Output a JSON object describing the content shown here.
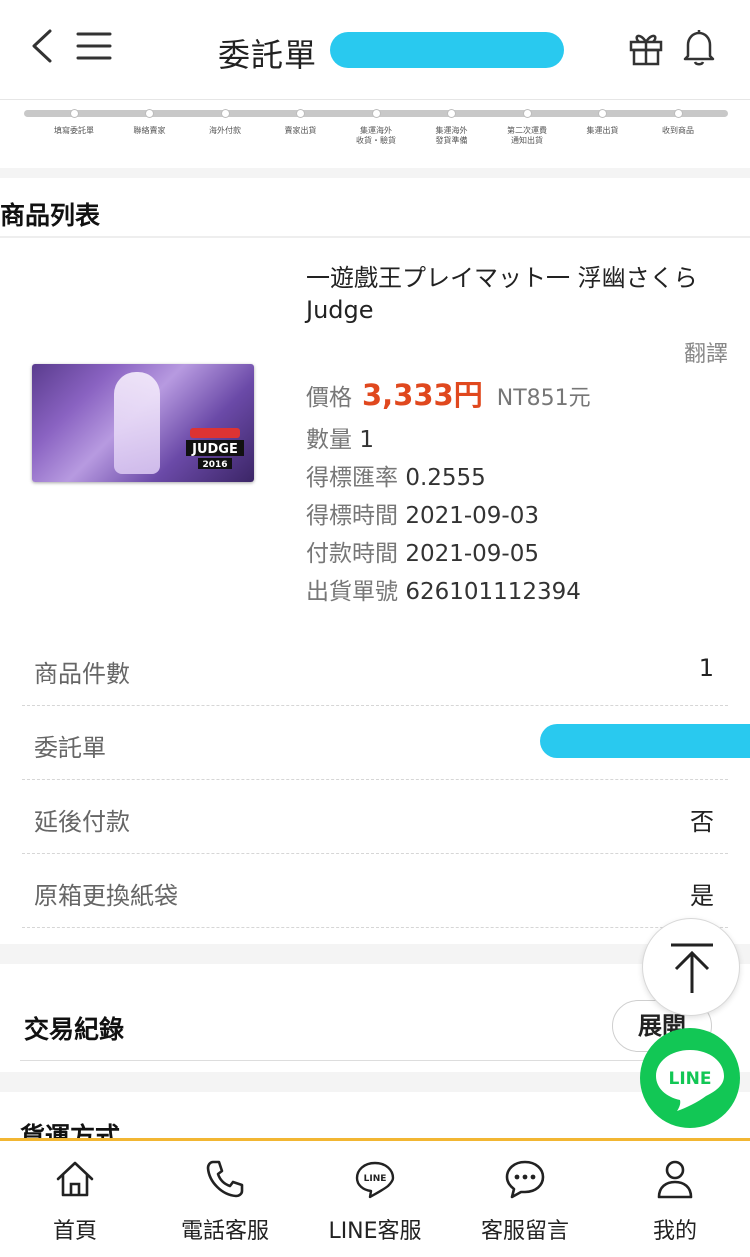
{
  "header": {
    "title": "委託單",
    "icons": [
      "back-icon",
      "menu-icon",
      "gift-icon",
      "bell-icon"
    ]
  },
  "progress": {
    "steps": [
      {
        "label": "填寫委託單"
      },
      {
        "label": "聯絡賣家"
      },
      {
        "label": "海外付款"
      },
      {
        "label": "賣家出貨"
      },
      {
        "label": "集運海外\n收貨・驗貨"
      },
      {
        "label": "集運海外\n發貨準備"
      },
      {
        "label": "第二次運費\n通知出貨"
      },
      {
        "label": "集運出貨"
      },
      {
        "label": "收到商品"
      }
    ]
  },
  "product_section": {
    "title": "商品列表",
    "item": {
      "name": "一遊戲王プレイマット一 浮幽さくら Judge",
      "translate_label": "翻譯",
      "price_label": "價格",
      "price": "3,333円",
      "price_ntd": "NT851元",
      "qty_label": "數量",
      "qty": "1",
      "rate_label": "得標匯率",
      "rate": "0.2555",
      "won_label": "得標時間",
      "won": "2021-09-03",
      "pay_label": "付款時間",
      "pay": "2021-09-05",
      "ship_no_label": "出貨單號",
      "ship_no": "626101112394",
      "image_text": "JUDGE 2016"
    }
  },
  "details": [
    {
      "key": "商品件數",
      "value": "1"
    },
    {
      "key": "委託單",
      "value": ""
    },
    {
      "key": "延後付款",
      "value": "否"
    },
    {
      "key": "原箱更換紙袋",
      "value": "是"
    }
  ],
  "transactions": {
    "title": "交易紀錄",
    "expand_label": "展開"
  },
  "shipping": {
    "title": "貨運方式"
  },
  "fab": {
    "line_label": "LINE",
    "accent": "#12c755"
  },
  "tabbar": {
    "accent": "#f2b632",
    "tabs": [
      {
        "label": "首頁",
        "icon": "home-icon"
      },
      {
        "label": "電話客服",
        "icon": "phone-icon"
      },
      {
        "label": "LINE客服",
        "icon": "line-icon"
      },
      {
        "label": "客服留言",
        "icon": "chat-icon"
      },
      {
        "label": "我的",
        "icon": "user-icon"
      }
    ]
  },
  "colors": {
    "price": "#e0481e",
    "redaction": "#29c9ef"
  }
}
